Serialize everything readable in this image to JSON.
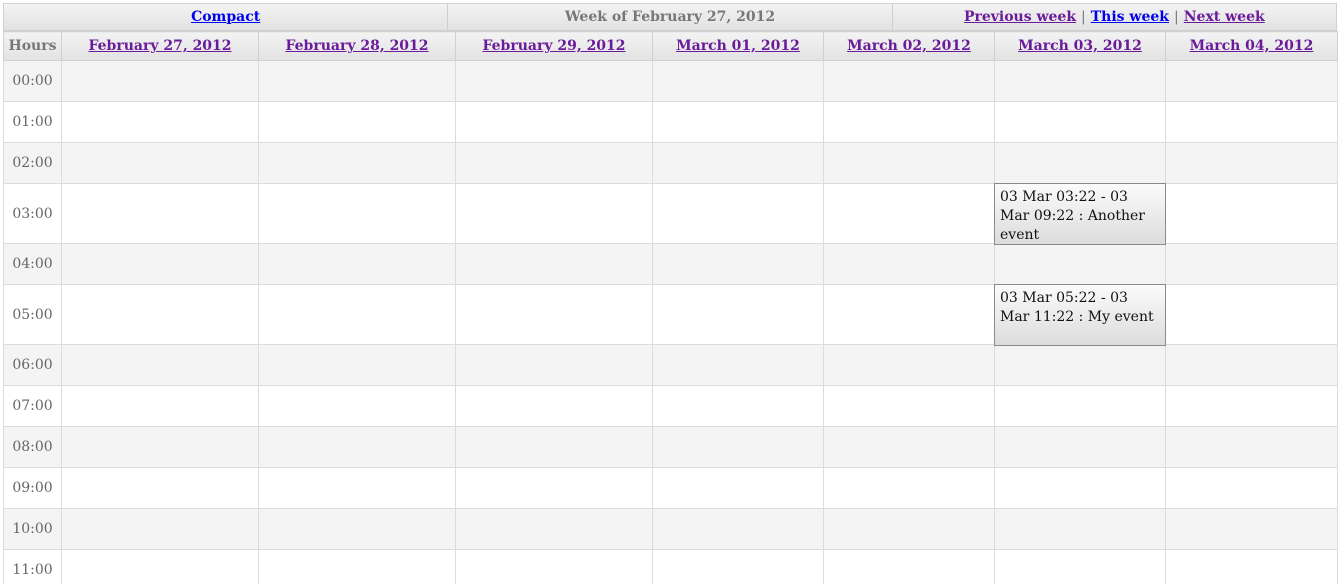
{
  "nav": {
    "compact_label": "Compact",
    "week_title": "Week of February 27, 2012",
    "previous_week_label": "Previous week",
    "this_week_label": "This week",
    "next_week_label": "Next week",
    "separator": "|"
  },
  "columns": {
    "hours_label": "Hours",
    "days": [
      "February 27, 2012",
      "February 28, 2012",
      "February 29, 2012",
      "March 01, 2012",
      "March 02, 2012",
      "March 03, 2012",
      "March 04, 2012"
    ]
  },
  "hours": [
    "00:00",
    "01:00",
    "02:00",
    "03:00",
    "04:00",
    "05:00",
    "06:00",
    "07:00",
    "08:00",
    "09:00",
    "10:00",
    "11:00"
  ],
  "events": [
    {
      "text": "03 Mar 03:22 - 03 Mar 09:22 : Another event"
    },
    {
      "text": "03 Mar 05:22 - 03 Mar 11:22 : My event"
    }
  ],
  "colors": {
    "link_visited": "#6a1b9a",
    "link": "#0000ee",
    "row_alt": "#f4f4f4",
    "header_bg": "#e2e2e2"
  }
}
